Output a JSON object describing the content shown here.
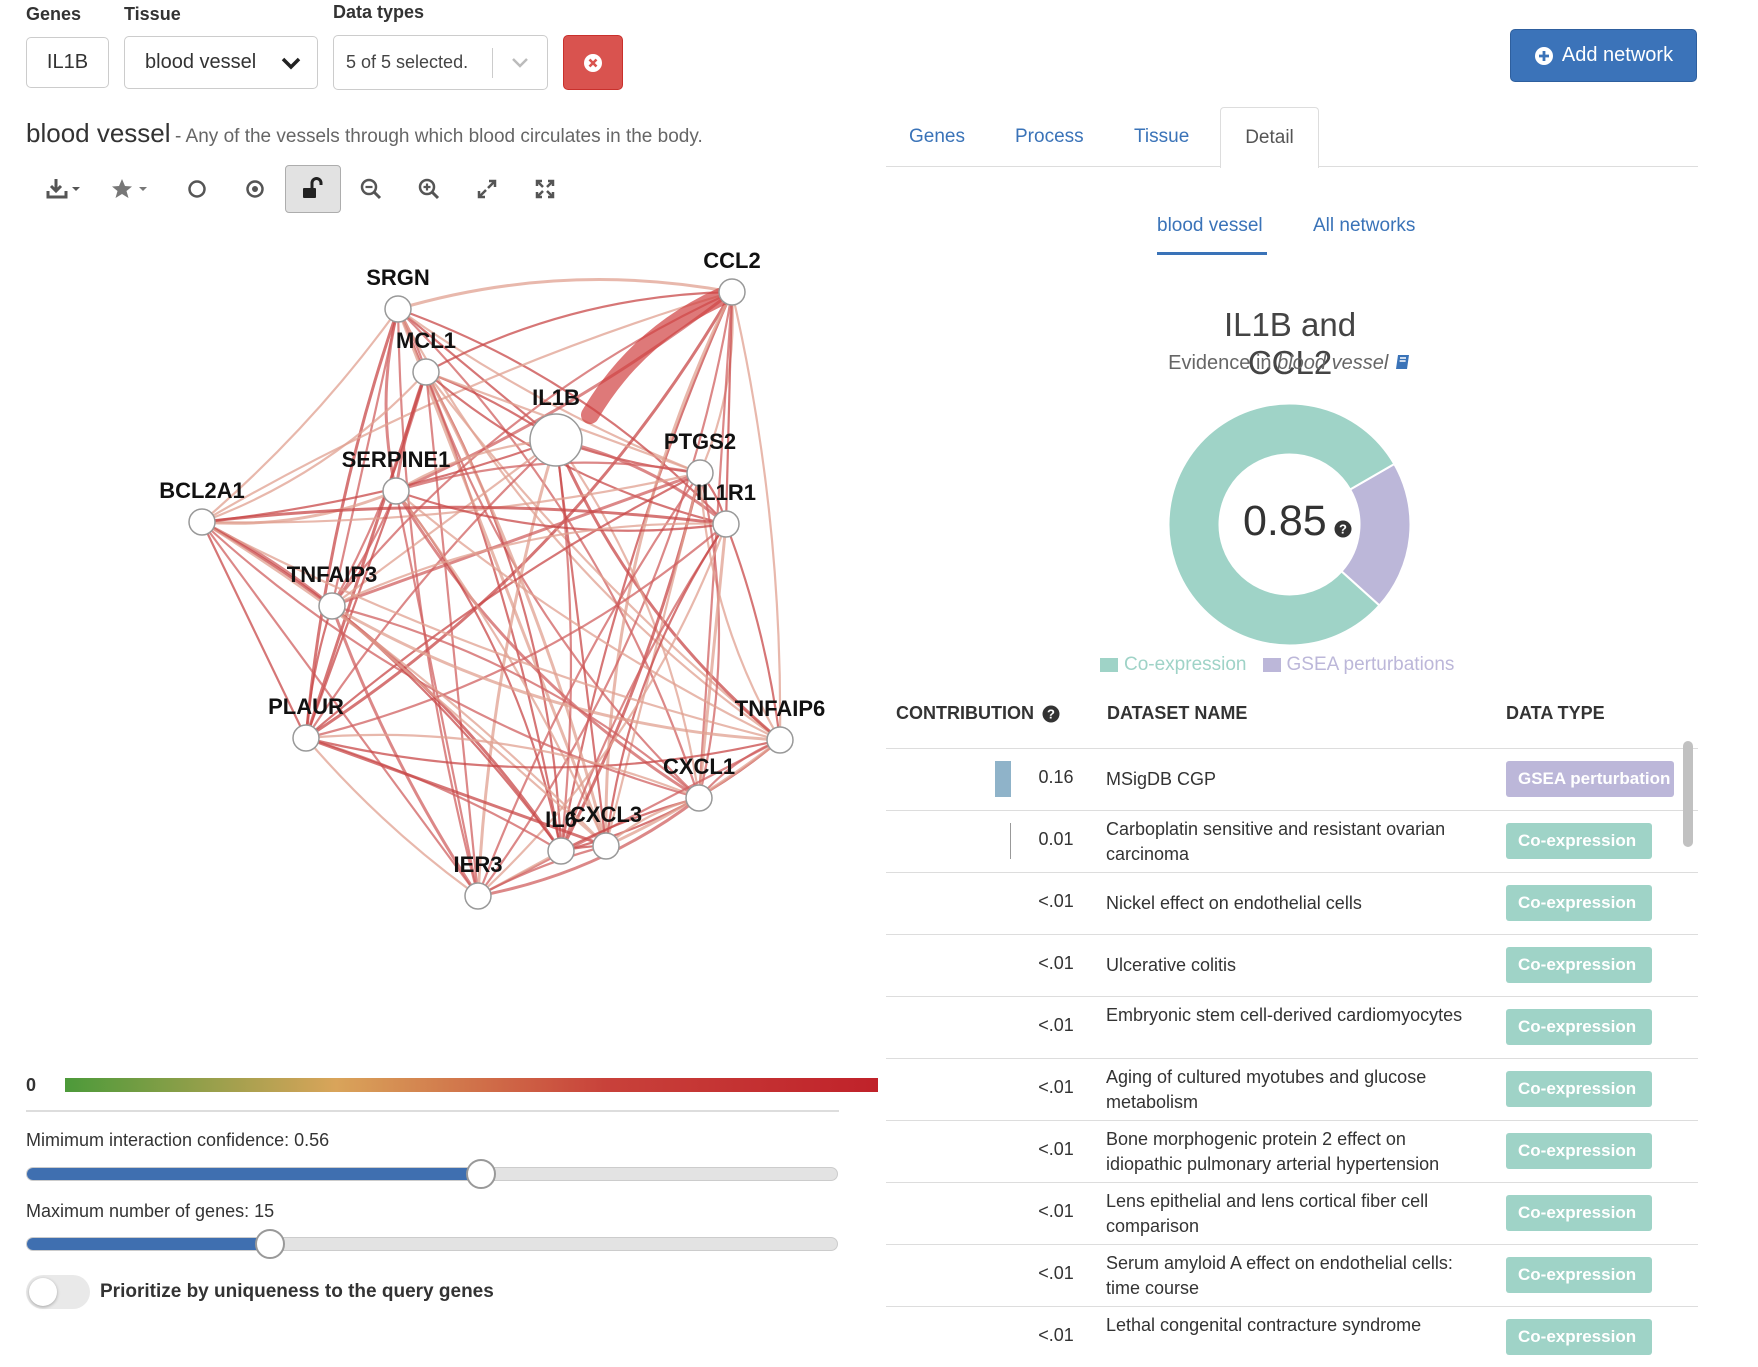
{
  "filters": {
    "genes_label": "Genes",
    "tissue_label": "Tissue",
    "datatypes_label": "Data types",
    "genes_value": "IL1B",
    "tissue_value": "blood vessel",
    "datatypes_value": "5 of 5 selected."
  },
  "add_network_label": "Add network",
  "heading": {
    "tissue": "blood vessel",
    "description": "- Any of the vessels through which blood circulates in the body."
  },
  "toolbar_icons": [
    "download-icon",
    "star-icon",
    "circle-icon",
    "target-icon",
    "lock-open-icon",
    "zoom-out-icon",
    "zoom-in-icon",
    "expand-icon",
    "fit-icon"
  ],
  "network": {
    "nodes": [
      "SRGN",
      "CCL2",
      "MCL1",
      "IL1B",
      "PTGS2",
      "SERPINE1",
      "IL1R1",
      "BCL2A1",
      "TNFAIP3",
      "PLAUR",
      "TNFAIP6",
      "CXCL1",
      "IL6",
      "CXCL3",
      "IER3"
    ]
  },
  "scale": {
    "min_label": "0",
    "colors": [
      "#4c9a3a",
      "#d9a45a",
      "#c8413a",
      "#c0222a"
    ]
  },
  "sliders": {
    "confidence_label": "Mimimum interaction confidence: 0.56",
    "confidence_value": 0.56,
    "genes_label": "Maximum number of genes: 15",
    "genes_fraction": 0.3
  },
  "toggle": {
    "label": "Prioritize by uniqueness to the query genes",
    "on": false
  },
  "tabs": [
    "Genes",
    "Process",
    "Tissue",
    "Detail"
  ],
  "active_tab": "Detail",
  "subtabs": [
    "blood vessel",
    "All networks"
  ],
  "detail": {
    "title": "IL1B and CCL2",
    "evidence_prefix": "Evidence in",
    "evidence_tissue": "blood vessel",
    "score": "0.85",
    "legend": [
      "Co-expression",
      "GSEA perturbations"
    ],
    "donut": [
      {
        "name": "Co-expression",
        "fraction": 0.8,
        "color": "#9fd3c7"
      },
      {
        "name": "GSEA perturbations",
        "fraction": 0.2,
        "color": "#bcb7d9"
      }
    ]
  },
  "table": {
    "headers": [
      "CONTRIBUTION",
      "DATASET NAME",
      "DATA TYPE"
    ],
    "rows": [
      {
        "contribution": "0.16",
        "bar": 0.16,
        "name": "MSigDB CGP",
        "type": "GSEA perturbations",
        "type_label": "GSEA perturbation"
      },
      {
        "contribution": "0.01",
        "bar": 0.01,
        "name": "Carboplatin sensitive and resistant ovarian carcinoma",
        "type": "Co-expression",
        "type_label": "Co-expression"
      },
      {
        "contribution": "<.01",
        "name": "Nickel effect on endothelial cells",
        "type": "Co-expression",
        "type_label": "Co-expression"
      },
      {
        "contribution": "<.01",
        "name": "Ulcerative colitis",
        "type": "Co-expression",
        "type_label": "Co-expression"
      },
      {
        "contribution": "<.01",
        "name": "Embryonic stem cell-derived cardiomyocytes",
        "type": "Co-expression",
        "type_label": "Co-expression"
      },
      {
        "contribution": "<.01",
        "name": "Aging of cultured myotubes and glucose metabolism",
        "type": "Co-expression",
        "type_label": "Co-expression"
      },
      {
        "contribution": "<.01",
        "name": "Bone morphogenic protein 2 effect on idiopathic pulmonary arterial hypertension",
        "type": "Co-expression",
        "type_label": "Co-expression"
      },
      {
        "contribution": "<.01",
        "name": "Lens epithelial and lens cortical fiber cell comparison",
        "type": "Co-expression",
        "type_label": "Co-expression"
      },
      {
        "contribution": "<.01",
        "name": "Serum amyloid A effect on endothelial cells: time course",
        "type": "Co-expression",
        "type_label": "Co-expression"
      },
      {
        "contribution": "<.01",
        "name": "Lethal congenital contracture syndrome",
        "type": "Co-expression",
        "type_label": "Co-expression"
      }
    ]
  }
}
